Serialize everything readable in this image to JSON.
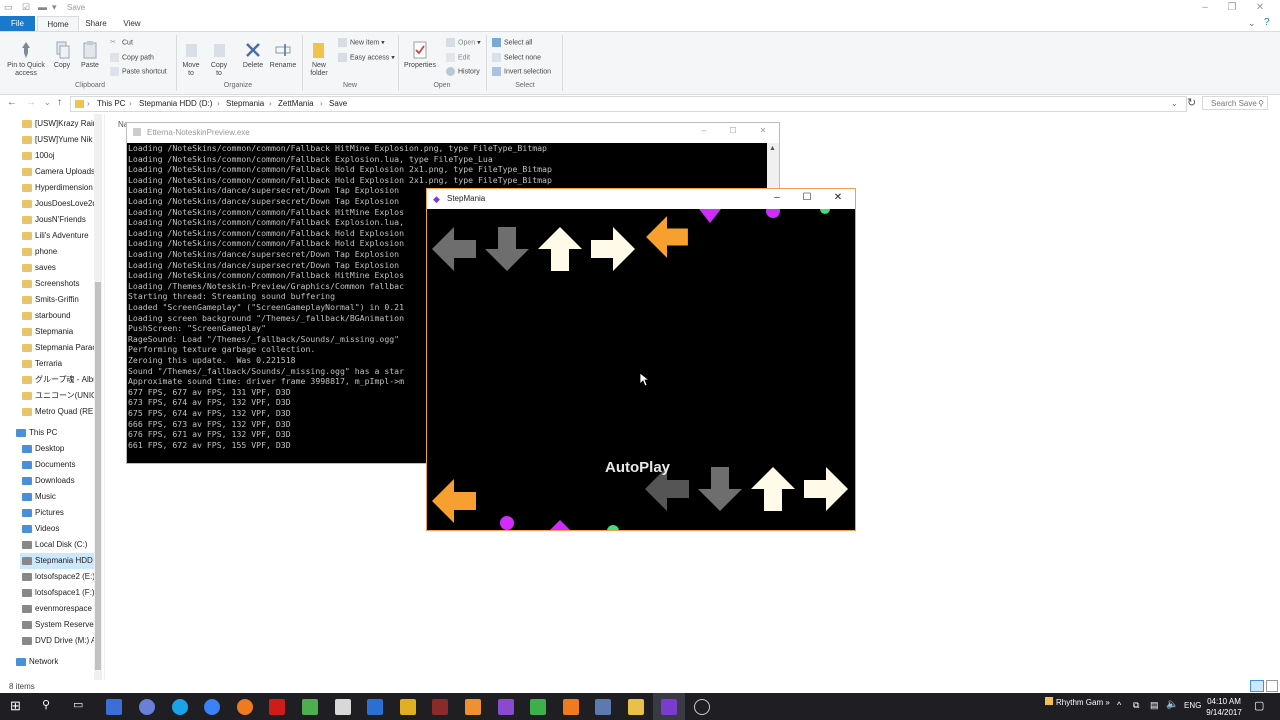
{
  "explorer": {
    "title": "Save",
    "tabs": [
      "File",
      "Home",
      "Share",
      "View"
    ],
    "ribbon": {
      "clipboard": {
        "pin": "Pin to Quick access",
        "copy": "Copy",
        "paste": "Paste",
        "cut": "Cut",
        "copy_path": "Copy path",
        "paste_shortcut": "Paste shortcut",
        "group": "Clipboard"
      },
      "organize": {
        "move_to": "Move to",
        "copy_to": "Copy to",
        "delete": "Delete",
        "rename": "Rename",
        "group": "Organize"
      },
      "new": {
        "new_folder": "New folder",
        "new_item": "New item",
        "easy_access": "Easy access",
        "group": "New"
      },
      "open": {
        "properties": "Properties",
        "open": "Open",
        "edit": "Edit",
        "history": "History",
        "group": "Open"
      },
      "select": {
        "select_all": "Select all",
        "select_none": "Select none",
        "invert": "Invert selection",
        "group": "Select"
      }
    },
    "breadcrumb": [
      "This PC",
      "Stepmania HDD (D:)",
      "Stepmania",
      "ZettMania",
      "Save"
    ],
    "search_placeholder": "Search Save",
    "col_fragment": "Na",
    "nav": [
      {
        "label": "[USW]Krazy Rain",
        "y": 0
      },
      {
        "label": "[USW]Yume Nik",
        "y": 1
      },
      {
        "label": "100oj",
        "y": 2
      },
      {
        "label": "Camera Uploads",
        "y": 3
      },
      {
        "label": "Hyperdimension",
        "y": 4
      },
      {
        "label": "JousDoesLove2d",
        "y": 5
      },
      {
        "label": "JousN'Friends",
        "y": 6
      },
      {
        "label": "Lili's Adventure",
        "y": 7
      },
      {
        "label": "phone",
        "y": 8
      },
      {
        "label": "saves",
        "y": 9
      },
      {
        "label": "Screenshots",
        "y": 10
      },
      {
        "label": "Smits-Griffin",
        "y": 11
      },
      {
        "label": "starbound",
        "y": 12
      },
      {
        "label": "Stepmania",
        "y": 13
      },
      {
        "label": "Stepmania Parac",
        "y": 14
      },
      {
        "label": "Terraria",
        "y": 15
      },
      {
        "label": "グループ魂 - Albu",
        "y": 16
      },
      {
        "label": "ユニコーン(UNICO",
        "y": 17
      },
      {
        "label": "Metro Quad (RE",
        "y": 18
      }
    ],
    "thispc": "This PC",
    "pc_items": [
      "Desktop",
      "Documents",
      "Downloads",
      "Music",
      "Pictures",
      "Videos",
      "Local Disk (C:)",
      "Stepmania HDD",
      "lotsofspace2 (E:)",
      "lotsofspace1 (F:)",
      "evenmorespace",
      "System Reserved",
      "DVD Drive (M:) A"
    ],
    "network": "Network",
    "status": "8 items"
  },
  "console": {
    "title": "Etterna-NoteskinPreview.exe",
    "lines": [
      "Loading /NoteSkins/common/common/Fallback HitMine Explosion.png, type FileType_Bitmap",
      "Loading /NoteSkins/common/common/Fallback Explosion.lua, type FileType_Lua",
      "Loading /NoteSkins/common/common/Fallback Hold Explosion 2x1.png, type FileType_Bitmap",
      "Loading /NoteSkins/common/common/Fallback Hold Explosion 2x1.png, type FileType_Bitmap",
      "Loading /NoteSkins/dance/supersecret/Down Tap Explosion",
      "Loading /NoteSkins/dance/supersecret/Down Tap Explosion",
      "Loading /NoteSkins/common/common/Fallback HitMine Explos",
      "Loading /NoteSkins/common/common/Fallback Explosion.lua,",
      "Loading /NoteSkins/common/common/Fallback Hold Explosion",
      "Loading /NoteSkins/common/common/Fallback Hold Explosion",
      "Loading /NoteSkins/dance/supersecret/Down Tap Explosion",
      "Loading /NoteSkins/dance/supersecret/Down Tap Explosion",
      "Loading /NoteSkins/common/common/Fallback HitMine Explos",
      "Loading /Themes/Noteskin-Preview/Graphics/Common fallbac",
      "Starting thread: Streaming sound buffering",
      "Loaded \"ScreenGameplay\" (\"ScreenGameplayNormal\") in 0.21",
      "Loading screen background \"/Themes/_fallback/BGAnimation",
      "PushScreen: \"ScreenGameplay\"",
      "RageSound: Load \"/Themes/_fallback/Sounds/_missing.ogg\"",
      "Performing texture garbage collection.",
      "Zeroing this update.  Was 0.221518",
      "Sound \"/Themes/_fallback/Sounds/_missing.ogg\" has a star",
      "Approximate sound time: driver frame 3998817, m_pImpl->m",
      "677 FPS, 677 av FPS, 131 VPF, D3D",
      "673 FPS, 674 av FPS, 132 VPF, D3D",
      "675 FPS, 674 av FPS, 132 VPF, D3D",
      "666 FPS, 673 av FPS, 132 VPF, D3D",
      "676 FPS, 671 av FPS, 132 VPF, D3D",
      "661 FPS, 672 av FPS, 155 VPF, D3D"
    ]
  },
  "stepmania": {
    "title": "StepMania",
    "autoplay": "AutoPlay"
  },
  "taskbar": {
    "pinned_app": "Rhythm Gam",
    "lang": "ENG",
    "time": "04:10 AM",
    "date": "9/14/2017"
  },
  "colors": {
    "accent": "#1979ca",
    "arrow_grey": "#6e6e6e",
    "arrow_white": "#fffbe8",
    "arrow_orange": "#f7a030",
    "purple": "#d02cff",
    "green": "#3fe07a"
  }
}
